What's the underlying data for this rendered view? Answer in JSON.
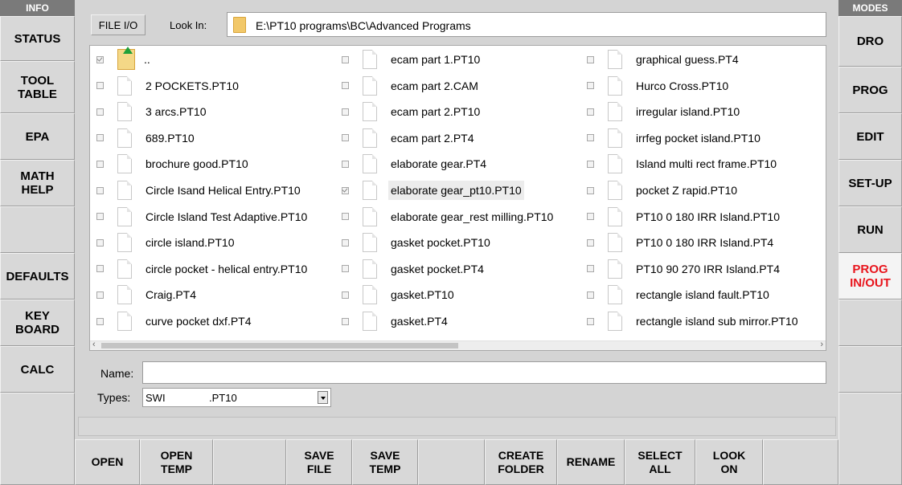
{
  "left_panel": {
    "header": "INFO",
    "buttons": [
      "STATUS",
      "TOOL\nTABLE",
      "EPA",
      "MATH\nHELP",
      "",
      "DEFAULTS",
      "KEY\nBOARD",
      "CALC",
      ""
    ]
  },
  "right_panel": {
    "header": "MODES",
    "buttons": [
      "DRO",
      "PROG",
      "EDIT",
      "SET-UP",
      "RUN",
      "PROG\nIN/OUT",
      "",
      "",
      ""
    ],
    "active_index": 5,
    "active_color": "#e8141c"
  },
  "file_io": {
    "label": "FILE I/O",
    "look_in_label": "Look In:",
    "look_in_path": "E:\\PT10 programs\\BC\\Advanced Programs"
  },
  "files": {
    "columns": [
      [
        {
          "name": "..",
          "checked": true,
          "icon": "up-folder-icon"
        },
        {
          "name": "2 POCKETS.PT10",
          "checked": false
        },
        {
          "name": "3 arcs.PT10",
          "checked": false
        },
        {
          "name": "689.PT10",
          "checked": false
        },
        {
          "name": "brochure good.PT10",
          "checked": false
        },
        {
          "name": "Circle Isand Helical Entry.PT10",
          "checked": false
        },
        {
          "name": "Circle Island Test Adaptive.PT10",
          "checked": false
        },
        {
          "name": "circle island.PT10",
          "checked": false
        },
        {
          "name": "circle pocket - helical entry.PT10",
          "checked": false
        },
        {
          "name": "Craig.PT4",
          "checked": false
        },
        {
          "name": "curve pocket dxf.PT4",
          "checked": false
        }
      ],
      [
        {
          "name": "ecam part 1.PT10",
          "checked": false
        },
        {
          "name": "ecam part 2.CAM",
          "checked": false
        },
        {
          "name": "ecam part 2.PT10",
          "checked": false
        },
        {
          "name": "ecam part 2.PT4",
          "checked": false
        },
        {
          "name": "elaborate gear.PT4",
          "checked": false
        },
        {
          "name": "elaborate gear_pt10.PT10",
          "checked": true,
          "selected": true
        },
        {
          "name": "elaborate gear_rest milling.PT10",
          "checked": false
        },
        {
          "name": "gasket pocket.PT10",
          "checked": false
        },
        {
          "name": "gasket pocket.PT4",
          "checked": false
        },
        {
          "name": "gasket.PT10",
          "checked": false
        },
        {
          "name": "gasket.PT4",
          "checked": false
        }
      ],
      [
        {
          "name": "graphical guess.PT4",
          "checked": false
        },
        {
          "name": "Hurco Cross.PT10",
          "checked": false
        },
        {
          "name": "irregular island.PT10",
          "checked": false
        },
        {
          "name": "irrfeg pocket island.PT10",
          "checked": false
        },
        {
          "name": "Island multi rect frame.PT10",
          "checked": false
        },
        {
          "name": "pocket Z rapid.PT10",
          "checked": false
        },
        {
          "name": "PT10 0 180 IRR Island.PT10",
          "checked": false
        },
        {
          "name": "PT10 0 180 IRR Island.PT4",
          "checked": false
        },
        {
          "name": "PT10 90 270 IRR Island.PT4",
          "checked": false
        },
        {
          "name": "rectangle island fault.PT10",
          "checked": false
        },
        {
          "name": "rectangle island sub mirror.PT10",
          "checked": false
        }
      ]
    ],
    "scroll_left_arrow": "‹",
    "scroll_right_arrow": "›"
  },
  "name_field": {
    "label": "Name:",
    "value": ""
  },
  "types_field": {
    "label": "Types:",
    "value_prefix": "SWI",
    "value_ext": ".PT10"
  },
  "bottom_buttons": [
    "",
    "OPEN",
    "OPEN\nTEMP",
    "",
    "SAVE\nFILE",
    "SAVE\nTEMP",
    "",
    "CREATE\nFOLDER",
    "RENAME",
    "SELECT\nALL",
    "LOOK\nON",
    "",
    ""
  ]
}
